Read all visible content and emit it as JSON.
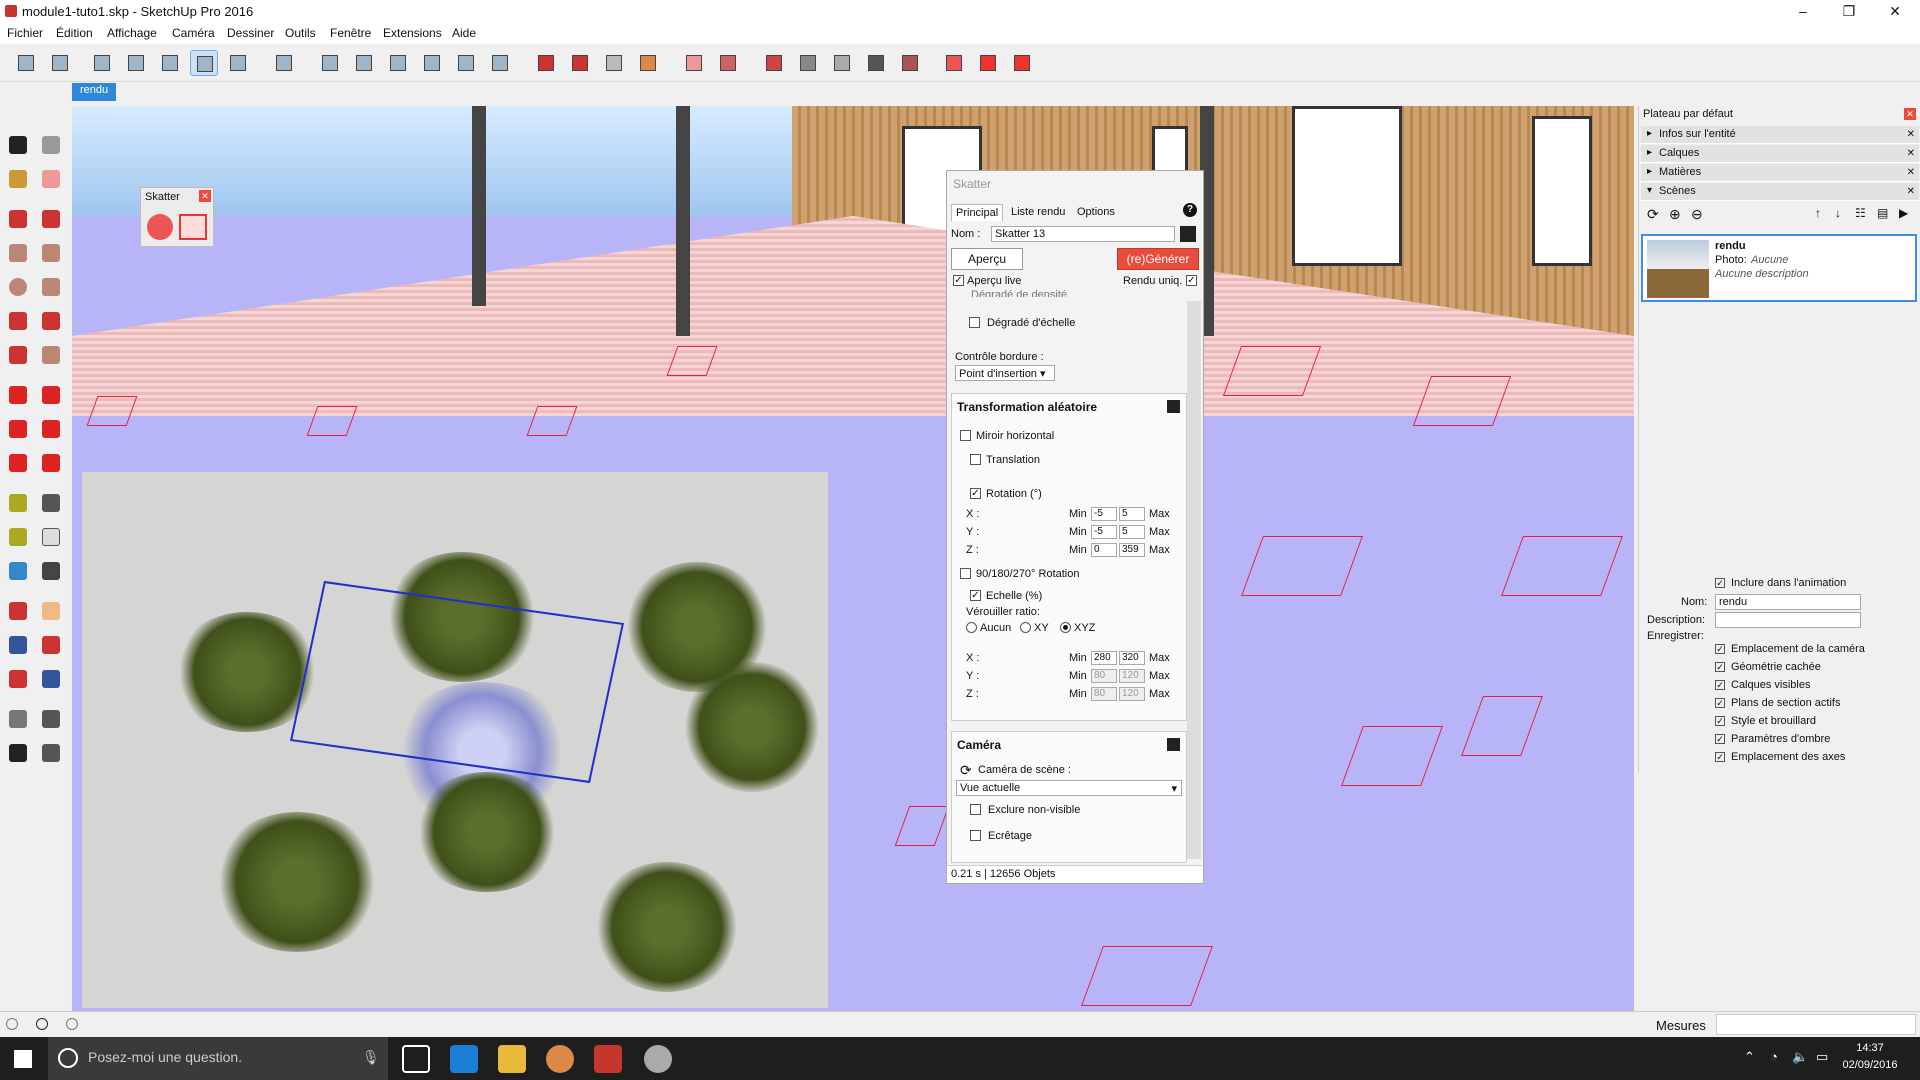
{
  "window": {
    "title": "module1-tuto1.skp - SketchUp Pro 2016"
  },
  "menu": [
    "Fichier",
    "Édition",
    "Affichage",
    "Caméra",
    "Dessiner",
    "Outils",
    "Fenêtre",
    "Extensions",
    "Aide"
  ],
  "scene_tab": "rendu",
  "skatter_mini": {
    "title": "Skatter"
  },
  "panel": {
    "title": "Skatter",
    "tabs": [
      "Principal",
      "Liste rendu",
      "Options"
    ],
    "name_label": "Nom :",
    "name_value": "Skatter 13",
    "preview_btn": "Aperçu",
    "generate_btn": "(re)Générer",
    "live_label": "Aperçu live",
    "render_label": "Rendu uniq.",
    "partial_label": "Dégradé de densité",
    "scale_grad_label": "Dégradé d'échelle",
    "border_label": "Contrôle bordure :",
    "border_value": "Point d'insertion",
    "transform": {
      "title": "Transformation aléatoire",
      "mirror": "Miroir horizontal",
      "translation": "Translation",
      "rotation": "Rotation (°)",
      "rot": [
        {
          "axis": "X :",
          "min": "-5",
          "max": "5"
        },
        {
          "axis": "Y :",
          "min": "-5",
          "max": "5"
        },
        {
          "axis": "Z :",
          "min": "0",
          "max": "359"
        }
      ],
      "min": "Min",
      "max": "Max",
      "rot90": "90/180/270° Rotation",
      "scale": "Echelle (%)",
      "lock": "Vérouiller ratio:",
      "radios": [
        "Aucun",
        "XY",
        "XYZ"
      ],
      "sc": [
        {
          "axis": "X :",
          "min": "280",
          "max": "320"
        },
        {
          "axis": "Y :",
          "min": "80",
          "max": "120"
        },
        {
          "axis": "Z :",
          "min": "80",
          "max": "120"
        }
      ]
    },
    "camera": {
      "title": "Caméra",
      "scene_cam": "Caméra de scène :",
      "view": "Vue actuelle",
      "exclude": "Exclure non-visible",
      "clip": "Ecrêtage"
    },
    "status": "0.21 s | 12656 Objets"
  },
  "tray": {
    "header": "Plateau par défaut",
    "items": [
      "Infos sur l'entité",
      "Calques",
      "Matières",
      "Scènes"
    ],
    "scene": {
      "name": "rendu",
      "photo_label": "Photo:",
      "photo_value": "Aucune",
      "desc": "Aucune description"
    },
    "include": "Inclure dans l'animation",
    "name_label": "Nom:",
    "name_value": "rendu",
    "desc_label": "Description:",
    "save_label": "Enregistrer:",
    "save_items": [
      "Emplacement de la caméra",
      "Géométrie cachée",
      "Calques visibles",
      "Plans de section actifs",
      "Style et brouillard",
      "Paramètres d'ombre",
      "Emplacement des axes"
    ]
  },
  "status": {
    "measures": "Mesures"
  },
  "taskbar": {
    "search": "Posez-moi une question.",
    "time": "14:37",
    "date": "02/09/2016"
  },
  "colors": {
    "accent": "#2e8ad8",
    "generate": "#e74c3c",
    "viewport": "#b7b4f8"
  }
}
